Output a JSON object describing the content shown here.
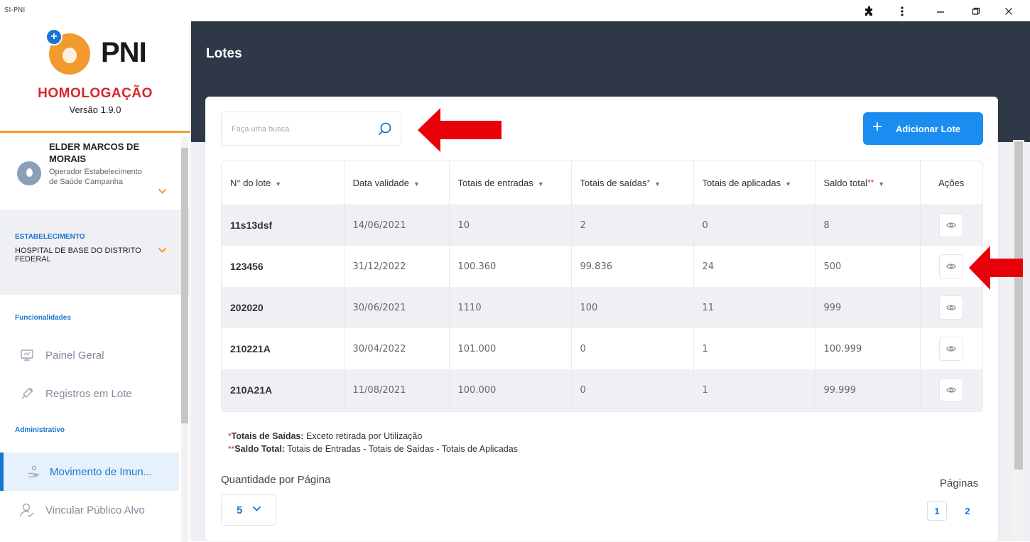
{
  "window": {
    "title": "SI-PNI",
    "controls": [
      "extensions-icon",
      "more-icon",
      "minimize-icon",
      "restore-icon",
      "close-icon"
    ]
  },
  "sidebar": {
    "logo_text": "PNI",
    "environment": "HOMOLOGAÇÃO",
    "version": "Versão 1.9.0",
    "user": {
      "name": "ELDER MARCOS DE MORAIS",
      "role": "Operador Estabelecimento de Saúde Campanha"
    },
    "establishment": {
      "title": "ESTABELECIMENTO",
      "name": "HOSPITAL DE BASE DO DISTRITO FEDERAL"
    },
    "sections": {
      "functionalities": "Funcionalidades",
      "administrative": "Administrativo"
    },
    "items": [
      {
        "label": "Painel Geral",
        "icon": "monitor-icon"
      },
      {
        "label": "Registros em Lote",
        "icon": "syringe-icon"
      },
      {
        "label": "Movimento de Imun...",
        "icon": "hand-icon",
        "active": true
      },
      {
        "label": "Vincular Público Alvo",
        "icon": "user-check-icon"
      }
    ]
  },
  "header": {
    "title": "Lotes"
  },
  "search": {
    "placeholder": "Faça uma busca"
  },
  "add_button": {
    "label": "Adicionar Lote"
  },
  "table": {
    "columns": [
      "N° do lote",
      "Data validade",
      "Totais de entradas",
      "Totais de saídas",
      "Totais de aplicadas",
      "Saldo total",
      "Ações"
    ],
    "rows": [
      {
        "lote": "11s13dsf",
        "validade": "14/06/2021",
        "entradas": "10",
        "saidas": "2",
        "aplicadas": "0",
        "saldo": "8"
      },
      {
        "lote": "123456",
        "validade": "31/12/2022",
        "entradas": "100.360",
        "saidas": "99.836",
        "aplicadas": "24",
        "saldo": "500"
      },
      {
        "lote": "202020",
        "validade": "30/06/2021",
        "entradas": "1110",
        "saidas": "100",
        "aplicadas": "11",
        "saldo": "999"
      },
      {
        "lote": "210221A",
        "validade": "30/04/2022",
        "entradas": "101.000",
        "saidas": "0",
        "aplicadas": "1",
        "saldo": "100.999"
      },
      {
        "lote": "210A21A",
        "validade": "11/08/2021",
        "entradas": "100.000",
        "saidas": "0",
        "aplicadas": "1",
        "saldo": "99.999"
      }
    ]
  },
  "notes": {
    "note1_title": "Totais de Saídas:",
    "note1_text": "Exceto retirada por Utilização",
    "note2_title": "Saldo Total:",
    "note2_text": "Totais de Entradas - Totais de Saídas - Totais de Aplicadas"
  },
  "pagination": {
    "qty_label": "Quantidade por Página",
    "qty_value": "5",
    "pages_label": "Páginas",
    "pages": [
      "1",
      "2"
    ],
    "current_page": "1"
  },
  "colors": {
    "header_bg": "#2e3846",
    "accent": "#1b8cf0",
    "brand_orange": "#f29a2e",
    "env_red": "#d9262b",
    "annotation_arrow": "#e8000b"
  }
}
